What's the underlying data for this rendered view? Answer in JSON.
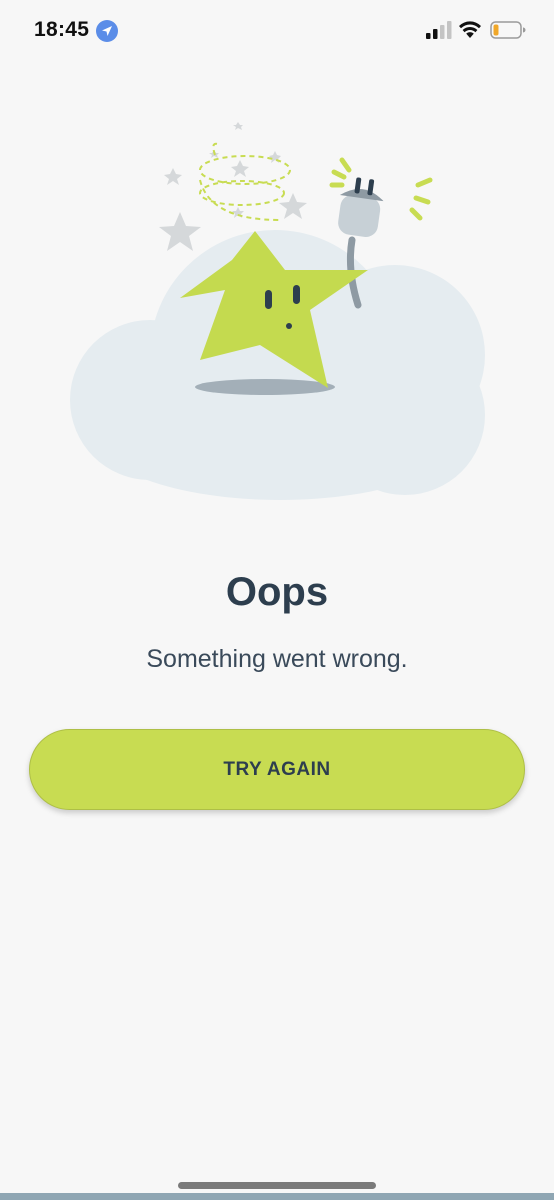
{
  "status_bar": {
    "time": "18:45",
    "icons": [
      "location-arrow-icon",
      "cellular-signal-icon",
      "wifi-icon",
      "battery-low-icon"
    ]
  },
  "illustration": {
    "description_icon": "unplugged-star-on-cloud-illustration"
  },
  "error": {
    "title": "Oops",
    "message": "Something went wrong."
  },
  "actions": {
    "try_again_label": "TRY AGAIN"
  },
  "colors": {
    "accent": "#c8dc52",
    "text_dark": "#2d3e4e",
    "background": "#f7f7f7",
    "cloud": "#e5ecf0"
  }
}
